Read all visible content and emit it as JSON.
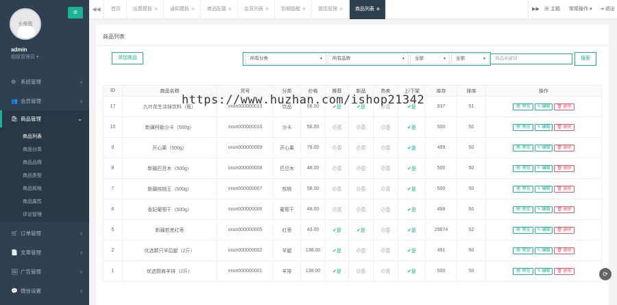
{
  "sidebar": {
    "avatar_text": "头像图",
    "username": "admin",
    "role": "超级管理员 ▾",
    "menu_toggle": "≡",
    "items": [
      {
        "icon": "⚙",
        "label": "系统管理",
        "arrow": "‹"
      },
      {
        "icon": "👥",
        "label": "会员管理",
        "arrow": "‹"
      },
      {
        "icon": "🛍",
        "label": "商品管理",
        "arrow": "⌄"
      },
      {
        "icon": "🛒",
        "label": "订单管理",
        "arrow": "‹"
      },
      {
        "icon": "📄",
        "label": "文章管理",
        "arrow": "‹"
      },
      {
        "icon": "🖼",
        "label": "广告管理",
        "arrow": "‹"
      },
      {
        "icon": "💬",
        "label": "微信设置",
        "arrow": "‹"
      }
    ],
    "sub_items": [
      "商品列表",
      "商品分类",
      "商品品牌",
      "商品类型",
      "商品规格",
      "商品属性",
      "评论管理"
    ]
  },
  "tabs": {
    "prev": "◀◀",
    "items": [
      "首页",
      "运费模板",
      "通知模板",
      "商品配置",
      "会员列表",
      "到期提醒",
      "提现管理",
      "商品列表"
    ],
    "next": "▶▶",
    "theme": "▦ 主题",
    "ops": "常用操作 ▾",
    "logout": "⇥ 退出"
  },
  "page": {
    "title": "商品列表",
    "add_button": "添加商品",
    "filters": {
      "category": "所有分类",
      "brand": "所有品牌",
      "status1": "全部",
      "status2": "全部"
    },
    "search_placeholder": "商品关键词",
    "search_button": "搜索"
  },
  "table": {
    "headers": [
      "ID",
      "商品名称",
      "货号",
      "分类",
      "价格",
      "推荐",
      "新品",
      "热卖",
      "上/下架",
      "库存",
      "排序",
      "操作"
    ],
    "actions": {
      "view": "👁 预览",
      "edit": "✎ 编辑",
      "del": "🗑 删除"
    },
    "yes_label": "✔是",
    "no_label": "⊘否",
    "rows": [
      {
        "id": "17",
        "name": "九叶花生涂抹饮料（瓶）",
        "sn": "vxun000000013",
        "cat": "饮品",
        "price": "68.00",
        "rec": true,
        "new": true,
        "hot": false,
        "onsale": true,
        "stock": "937",
        "sort": "51"
      },
      {
        "id": "10",
        "name": "新疆阿勒沙卡（500g）",
        "sn": "vxun000000010",
        "cat": "沙卡",
        "price": "58.00",
        "rec": false,
        "new": false,
        "hot": false,
        "onsale": true,
        "stock": "500",
        "sort": "50"
      },
      {
        "id": "9",
        "name": "开心果（500g）",
        "sn": "vxun000000009",
        "cat": "开心果",
        "price": "78.00",
        "rec": false,
        "new": false,
        "hot": false,
        "onsale": true,
        "stock": "499",
        "sort": "50"
      },
      {
        "id": "8",
        "name": "新疆巴旦木（500g）",
        "sn": "vxun000000008",
        "cat": "巴旦木",
        "price": "48.00",
        "rec": false,
        "new": false,
        "hot": false,
        "onsale": true,
        "stock": "500",
        "sort": "50"
      },
      {
        "id": "7",
        "name": "新疆核桃王（500g）",
        "sn": "vxun000000007",
        "cat": "核桃",
        "price": "58.00",
        "rec": false,
        "new": false,
        "hot": false,
        "onsale": true,
        "stock": "500",
        "sort": "50"
      },
      {
        "id": "6",
        "name": "香妃葡萄干（500g）",
        "sn": "vxun000000006",
        "cat": "葡萄干",
        "price": "48.00",
        "rec": false,
        "new": false,
        "hot": false,
        "onsale": true,
        "stock": "498",
        "sort": "50"
      },
      {
        "id": "5",
        "name": "新疆若羌红枣",
        "sn": "vxun000000005",
        "cat": "红枣",
        "price": "43.00",
        "rec": true,
        "new": true,
        "hot": false,
        "onsale": true,
        "stock": "29874",
        "sort": "52"
      },
      {
        "id": "2",
        "name": "优选颗只羊后腿（2斤）",
        "sn": "vxun000000002",
        "cat": "羊腿",
        "price": "138.00",
        "rec": true,
        "new": false,
        "hot": false,
        "onsale": true,
        "stock": "491",
        "sort": "50"
      },
      {
        "id": "1",
        "name": "优选颗肩羊排（2斤）",
        "sn": "vxun000000001",
        "cat": "羊排",
        "price": "138.00",
        "rec": true,
        "new": false,
        "hot": false,
        "onsale": true,
        "stock": "500",
        "sort": "50"
      }
    ]
  },
  "watermark": "https://www.huzhan.com/ishop21342",
  "float_icon": "⟳",
  "colors": {
    "sidebar": "#2f4050",
    "accent": "#1ab394",
    "danger": "#ed5565"
  }
}
